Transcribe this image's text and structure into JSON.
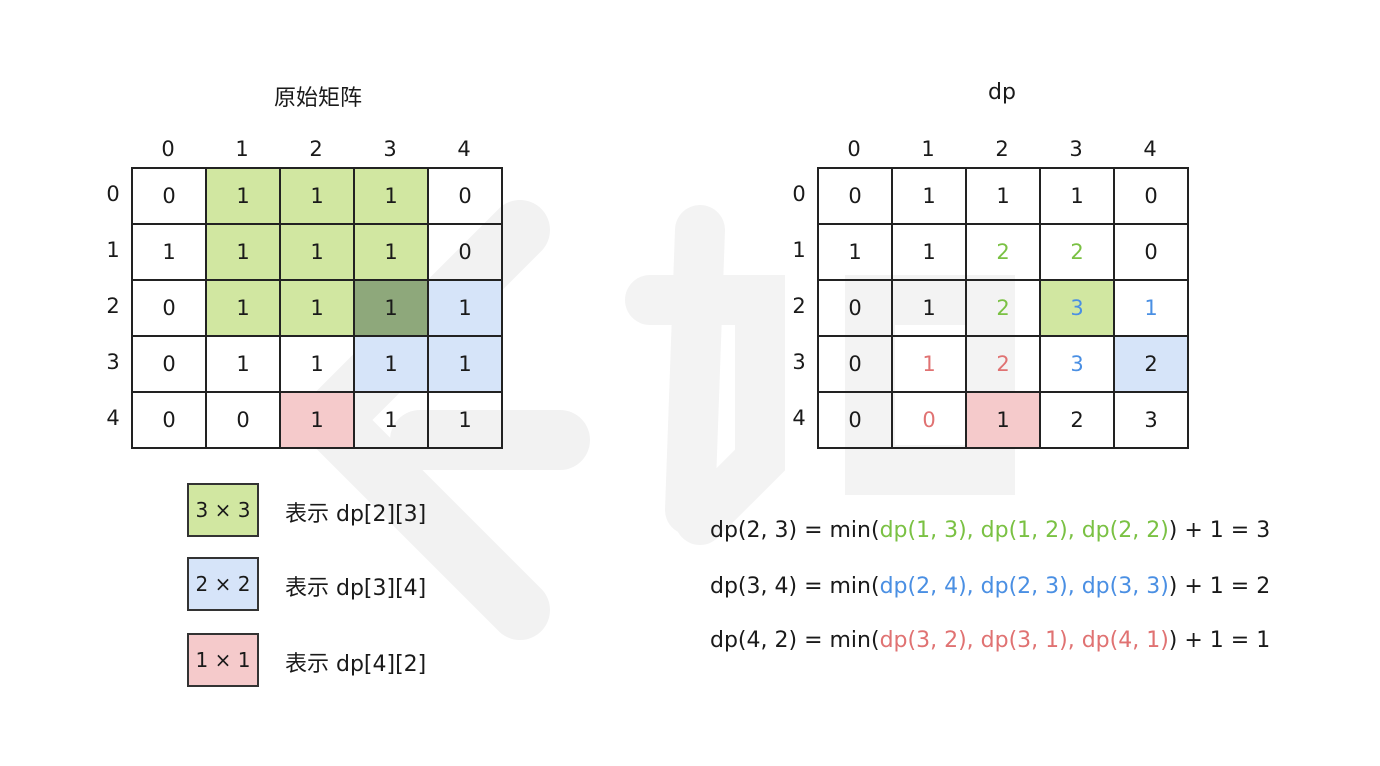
{
  "left": {
    "title": "原始矩阵",
    "col_headers": [
      "0",
      "1",
      "2",
      "3",
      "4"
    ],
    "row_headers": [
      "0",
      "1",
      "2",
      "3",
      "4"
    ],
    "rows": [
      [
        "0",
        "1",
        "1",
        "1",
        "0"
      ],
      [
        "1",
        "1",
        "1",
        "1",
        "0"
      ],
      [
        "0",
        "1",
        "1",
        "1",
        "1"
      ],
      [
        "0",
        "1",
        "1",
        "1",
        "1"
      ],
      [
        "0",
        "0",
        "1",
        "1",
        "1"
      ]
    ],
    "fills": [
      [
        "",
        "green",
        "green",
        "green",
        ""
      ],
      [
        "",
        "green",
        "green",
        "green",
        ""
      ],
      [
        "",
        "green",
        "green",
        "overlap",
        "blue"
      ],
      [
        "",
        "",
        "",
        "blue",
        "blue"
      ],
      [
        "",
        "",
        "red",
        "",
        ""
      ]
    ]
  },
  "right": {
    "title": "dp",
    "col_headers": [
      "0",
      "1",
      "2",
      "3",
      "4"
    ],
    "row_headers": [
      "0",
      "1",
      "2",
      "3",
      "4"
    ],
    "rows": [
      [
        "0",
        "1",
        "1",
        "1",
        "0"
      ],
      [
        "1",
        "1",
        "2",
        "2",
        "0"
      ],
      [
        "0",
        "1",
        "2",
        "3",
        "1"
      ],
      [
        "0",
        "1",
        "2",
        "3",
        "2"
      ],
      [
        "0",
        "0",
        "1",
        "2",
        "3"
      ]
    ],
    "fills": [
      [
        "",
        "",
        "",
        "",
        ""
      ],
      [
        "",
        "",
        "",
        "",
        ""
      ],
      [
        "",
        "",
        "",
        "green",
        ""
      ],
      [
        "",
        "",
        "",
        "",
        "blue"
      ],
      [
        "",
        "",
        "red",
        "",
        ""
      ]
    ],
    "text_colors": [
      [
        "",
        "",
        "",
        "",
        ""
      ],
      [
        "",
        "",
        "green",
        "green",
        ""
      ],
      [
        "",
        "",
        "green",
        "blue",
        "blue"
      ],
      [
        "",
        "red",
        "red",
        "blue",
        ""
      ],
      [
        "",
        "red",
        "",
        "",
        ""
      ]
    ]
  },
  "colors": {
    "green_fill": "#d1e7a1",
    "blue_fill": "#d6e4f9",
    "red_fill": "#f5cacb",
    "overlap_fill": "#8ea87b",
    "green_text": "#7ac143",
    "blue_text": "#4a8fe3",
    "red_text": "#e07272"
  },
  "legend": [
    {
      "box": "3 × 3",
      "text": "表示 dp[2][3]",
      "color": "green"
    },
    {
      "box": "2 × 2",
      "text": "表示 dp[3][4]",
      "color": "blue"
    },
    {
      "box": "1 × 1",
      "text": "表示 dp[4][2]",
      "color": "red"
    }
  ],
  "formulas": [
    {
      "prefix": "dp(2, 3) = min(",
      "args": "dp(1, 3), dp(1, 2), dp(2, 2)",
      "suffix": ") + 1 = 3",
      "color": "green"
    },
    {
      "prefix": "dp(3, 4) = min(",
      "args": "dp(2, 4), dp(2, 3), dp(3, 3)",
      "suffix": ") + 1 = 2",
      "color": "blue"
    },
    {
      "prefix": "dp(4, 2) = min(",
      "args": "dp(3, 2), dp(3, 1), dp(4, 1)",
      "suffix": ") + 1 = 1",
      "color": "red"
    }
  ]
}
